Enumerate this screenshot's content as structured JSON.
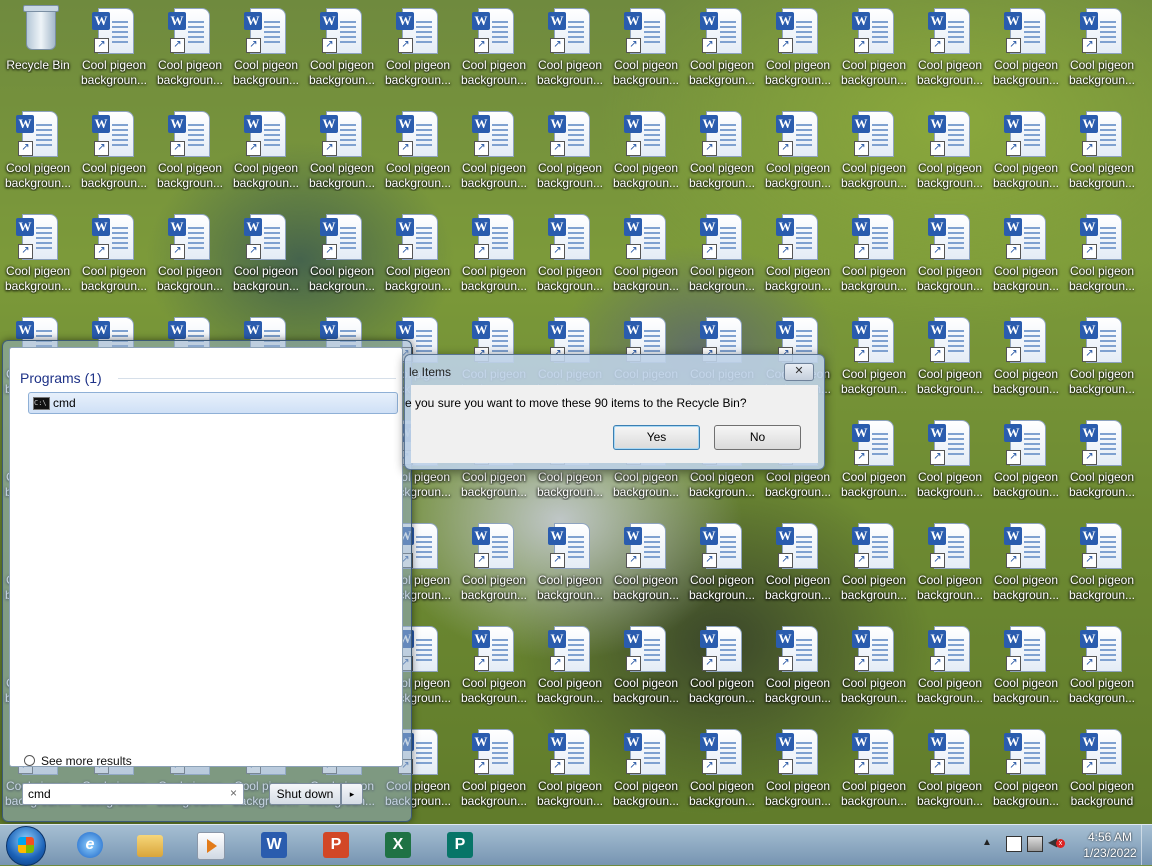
{
  "desktop": {
    "recycle_bin_label": "Recycle Bin",
    "file_label_line1": "Cool pigeon",
    "file_label_line2": "backgroun...",
    "last_file_label_line2": "background"
  },
  "start_menu": {
    "programs_header": "Programs (1)",
    "result_label": "cmd",
    "cmd_icon_text": "C:\\",
    "see_more": "See more results",
    "search_value": "cmd",
    "clear_glyph": "×",
    "shutdown_label": "Shut down",
    "shutdown_arrow": "▸"
  },
  "dialog": {
    "title": "le Items",
    "message": "e you sure you want to move these 90 items to the Recycle Bin?",
    "yes_label": "Yes",
    "no_label": "No",
    "close_glyph": "✕"
  },
  "taskbar": {
    "pinned": [
      {
        "name": "internet-explorer",
        "glyph": "e"
      },
      {
        "name": "windows-explorer",
        "glyph": ""
      },
      {
        "name": "media-player",
        "glyph": ""
      },
      {
        "name": "word",
        "glyph": "W"
      },
      {
        "name": "powerpoint",
        "glyph": "P"
      },
      {
        "name": "excel",
        "glyph": "X"
      },
      {
        "name": "publisher",
        "glyph": "P"
      }
    ],
    "tray_up_glyph": "▲",
    "volume_glyph": "◀",
    "muted_glyph": "x",
    "time": "4:56 AM",
    "date": "1/23/2022"
  }
}
